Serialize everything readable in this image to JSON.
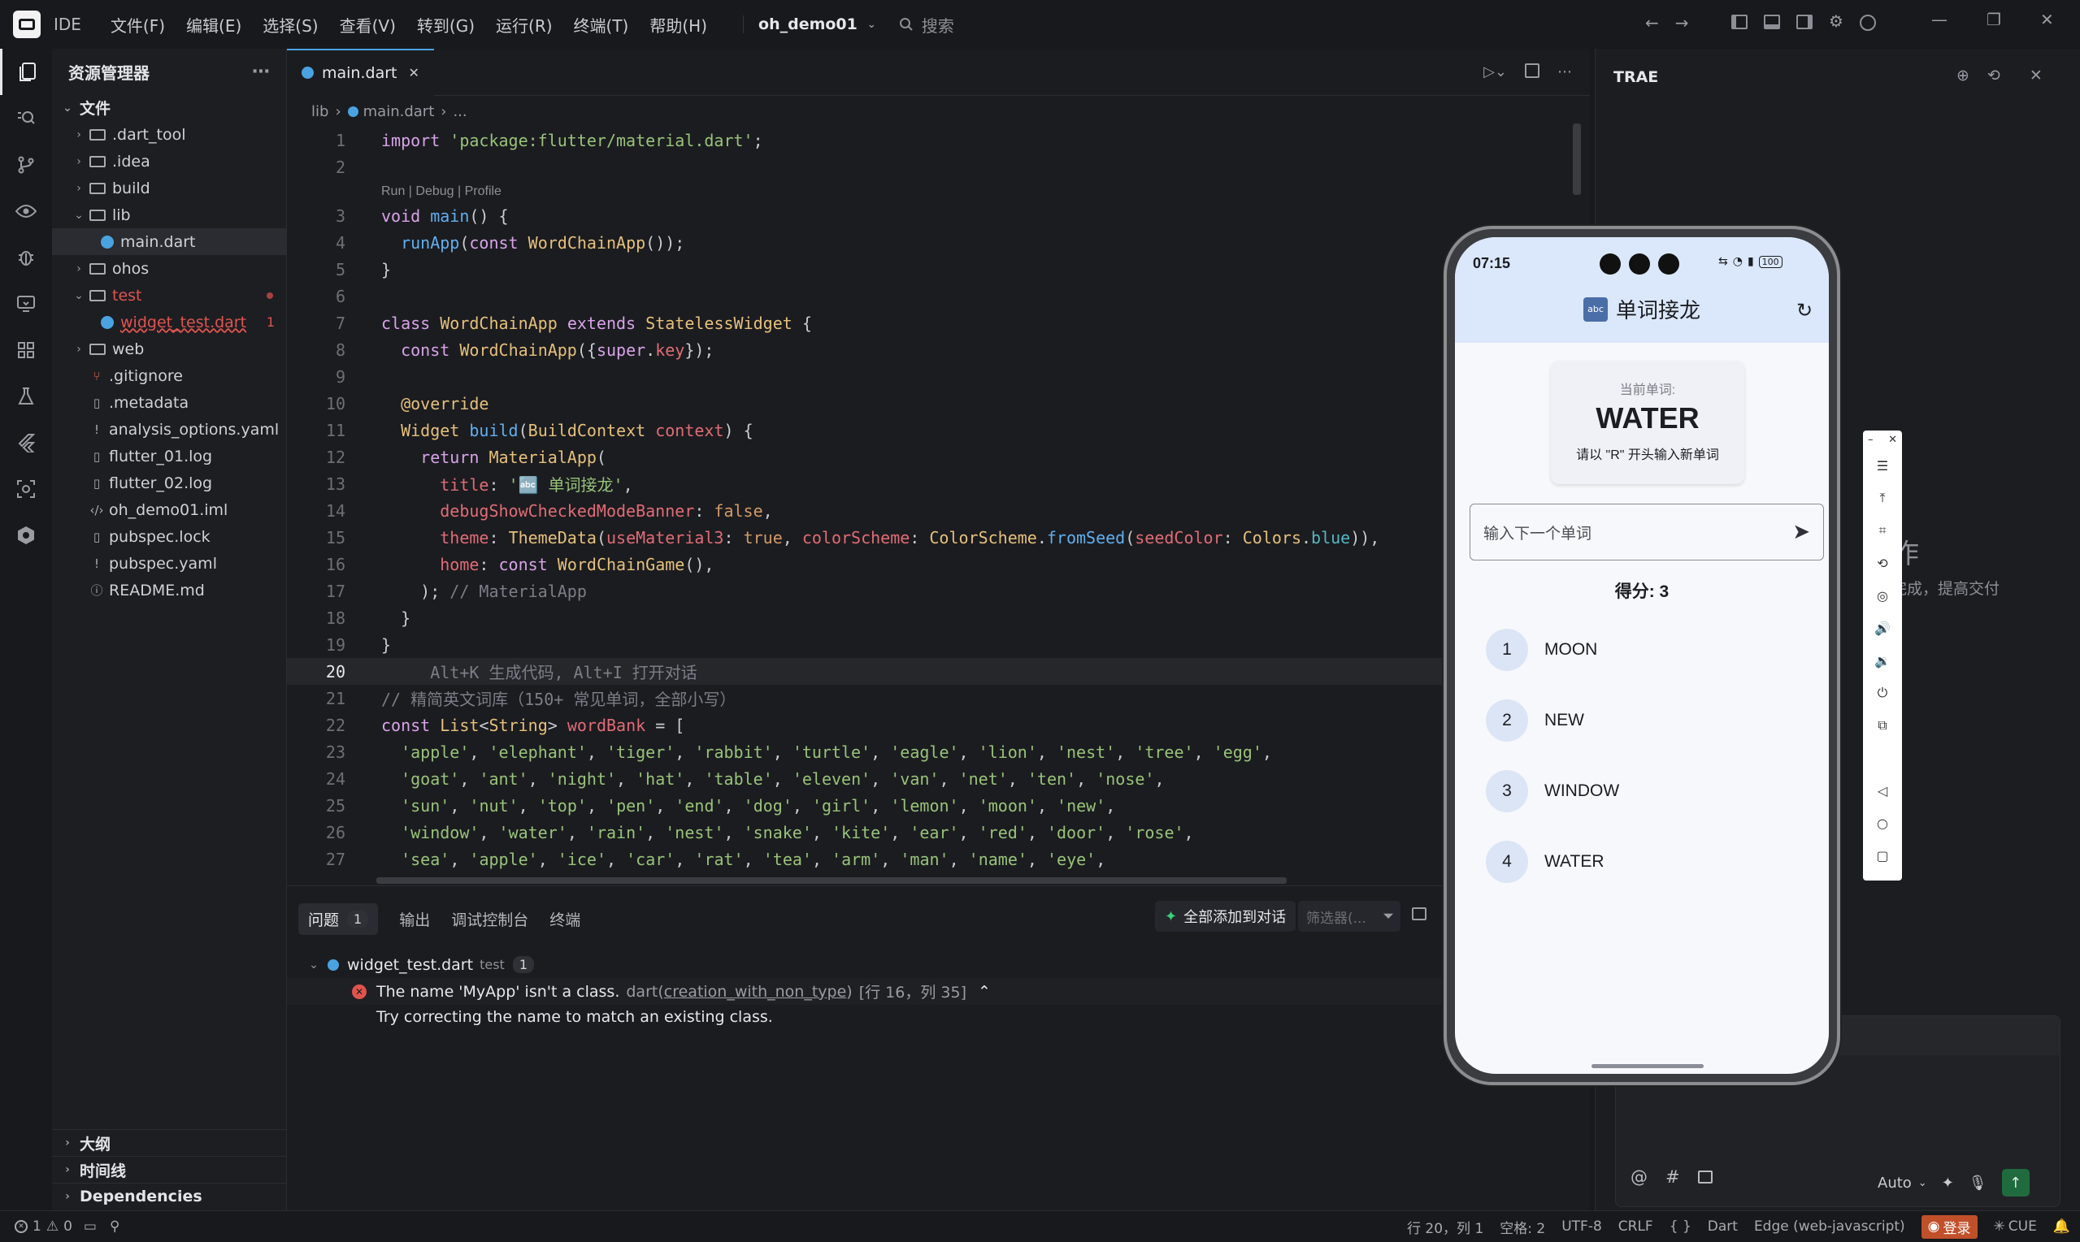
{
  "titlebar": {
    "ide_label": "IDE",
    "menus": [
      "文件(F)",
      "编辑(E)",
      "选择(S)",
      "查看(V)",
      "转到(G)",
      "运行(R)",
      "终端(T)",
      "帮助(H)"
    ],
    "project": "oh_demo01",
    "search_placeholder": "搜索"
  },
  "explorer": {
    "title": "资源管理器",
    "root": "文件",
    "items": [
      {
        "label": ".dart_tool",
        "type": "folder",
        "indent": 1,
        "expanded": false
      },
      {
        "label": ".idea",
        "type": "folder",
        "indent": 1,
        "expanded": false
      },
      {
        "label": "build",
        "type": "folder",
        "indent": 1,
        "expanded": false
      },
      {
        "label": "lib",
        "type": "folder",
        "indent": 1,
        "expanded": true
      },
      {
        "label": "main.dart",
        "type": "dart",
        "indent": 2,
        "selected": true
      },
      {
        "label": "ohos",
        "type": "folder",
        "indent": 1,
        "expanded": false
      },
      {
        "label": "test",
        "type": "folder",
        "indent": 1,
        "expanded": true,
        "error": true
      },
      {
        "label": "widget_test.dart",
        "type": "dart",
        "indent": 2,
        "error": true,
        "error_count": "1"
      },
      {
        "label": "web",
        "type": "folder",
        "indent": 1,
        "expanded": false
      },
      {
        "label": ".gitignore",
        "type": "git",
        "indent": 1
      },
      {
        "label": ".metadata",
        "type": "file",
        "indent": 1
      },
      {
        "label": "analysis_options.yaml",
        "type": "yaml",
        "indent": 1
      },
      {
        "label": "flutter_01.log",
        "type": "file",
        "indent": 1
      },
      {
        "label": "flutter_02.log",
        "type": "file",
        "indent": 1
      },
      {
        "label": "oh_demo01.iml",
        "type": "xml",
        "indent": 1
      },
      {
        "label": "pubspec.lock",
        "type": "file",
        "indent": 1
      },
      {
        "label": "pubspec.yaml",
        "type": "yaml",
        "indent": 1
      },
      {
        "label": "README.md",
        "type": "info",
        "indent": 1
      }
    ],
    "sections": [
      "大纲",
      "时间线",
      "Dependencies"
    ]
  },
  "editor": {
    "tab_label": "main.dart",
    "breadcrumb": [
      "lib",
      "main.dart",
      "..."
    ],
    "codelens": "Run | Debug | Profile",
    "current_line": 20,
    "lines": [
      {
        "n": 1,
        "html": "<span class='k'>import</span> <span class='s'>'package:flutter/material.dart'</span>;"
      },
      {
        "n": 2,
        "html": ""
      },
      {
        "n": 3,
        "html": "<span class='k'>void</span> <span class='f'>main</span>() {",
        "lens": true
      },
      {
        "n": 4,
        "html": "  <span class='f'>runApp</span>(<span class='k'>const</span> <span class='t'>WordChainApp</span>());"
      },
      {
        "n": 5,
        "html": "}"
      },
      {
        "n": 6,
        "html": ""
      },
      {
        "n": 7,
        "html": "<span class='k'>class</span> <span class='t'>WordChainApp</span> <span class='k'>extends</span> <span class='t'>StatelessWidget</span> {"
      },
      {
        "n": 8,
        "html": "  <span class='k'>const</span> <span class='t'>WordChainApp</span>({<span class='k'>super</span>.<span class='r'>key</span>});"
      },
      {
        "n": 9,
        "html": ""
      },
      {
        "n": 10,
        "html": "  <span class='p'>@override</span>"
      },
      {
        "n": 11,
        "html": "  <span class='t'>Widget</span> <span class='f'>build</span>(<span class='t'>BuildContext</span> <span class='r'>context</span>) {"
      },
      {
        "n": 12,
        "html": "    <span class='k'>return</span> <span class='t'>MaterialApp</span>("
      },
      {
        "n": 13,
        "html": "      <span class='r'>title</span>: <span class='s'>'🔤 单词接龙'</span>,"
      },
      {
        "n": 14,
        "html": "      <span class='r'>debugShowCheckedModeBanner</span>: <span class='n'>false</span>,"
      },
      {
        "n": 15,
        "html": "      <span class='r'>theme</span>: <span class='t'>ThemeData</span>(<span class='r'>useMaterial3</span>: <span class='n'>true</span>, <span class='r'>colorScheme</span>: <span class='t'>ColorScheme</span>.<span class='f'>fromSeed</span>(<span class='r'>seedColor</span>: <span class='t'>Colors</span>.<span class='b'>blue</span>)),"
      },
      {
        "n": 16,
        "html": "      <span class='r'>home</span>: <span class='k'>const</span> <span class='t'>WordChainGame</span>(),"
      },
      {
        "n": 17,
        "html": "    ); <span class='c'>// MaterialApp</span>"
      },
      {
        "n": 18,
        "html": "  }"
      },
      {
        "n": 19,
        "html": "}"
      },
      {
        "n": 20,
        "html": "     <span class='c'>Alt+K 生成代码, Alt+I 打开对话</span>"
      },
      {
        "n": 21,
        "html": "<span class='c'>// 精简英文词库（150+ 常见单词，全部小写）</span>"
      },
      {
        "n": 22,
        "html": "<span class='k'>const</span> <span class='t'>List</span>&lt;<span class='t'>String</span>&gt; <span class='r'>wordBank</span> = ["
      },
      {
        "n": 23,
        "html": "  <span class='s'>'apple'</span>, <span class='s'>'elephant'</span>, <span class='s'>'tiger'</span>, <span class='s'>'rabbit'</span>, <span class='s'>'turtle'</span>, <span class='s'>'eagle'</span>, <span class='s'>'lion'</span>, <span class='s'>'nest'</span>, <span class='s'>'tree'</span>, <span class='s'>'egg'</span>,"
      },
      {
        "n": 24,
        "html": "  <span class='s'>'goat'</span>, <span class='s'>'ant'</span>, <span class='s'>'night'</span>, <span class='s'>'hat'</span>, <span class='s'>'table'</span>, <span class='s'>'eleven'</span>, <span class='s'>'van'</span>, <span class='s'>'net'</span>, <span class='s'>'ten'</span>, <span class='s'>'nose'</span>,"
      },
      {
        "n": 25,
        "html": "  <span class='s'>'sun'</span>, <span class='s'>'nut'</span>, <span class='s'>'top'</span>, <span class='s'>'pen'</span>, <span class='s'>'end'</span>, <span class='s'>'dog'</span>, <span class='s'>'girl'</span>, <span class='s'>'lemon'</span>, <span class='s'>'moon'</span>, <span class='s'>'new'</span>,"
      },
      {
        "n": 26,
        "html": "  <span class='s'>'window'</span>, <span class='s'>'water'</span>, <span class='s'>'rain'</span>, <span class='s'>'nest'</span>, <span class='s'>'snake'</span>, <span class='s'>'kite'</span>, <span class='s'>'ear'</span>, <span class='s'>'red'</span>, <span class='s'>'door'</span>, <span class='s'>'rose'</span>,"
      },
      {
        "n": 27,
        "html": "  <span class='s'>'sea'</span>, <span class='s'>'apple'</span>, <span class='s'>'ice'</span>, <span class='s'>'car'</span>, <span class='s'>'rat'</span>, <span class='s'>'tea'</span>, <span class='s'>'arm'</span>, <span class='s'>'man'</span>, <span class='s'>'name'</span>, <span class='s'>'eye'</span>,"
      }
    ]
  },
  "panel": {
    "tabs": [
      "问题",
      "输出",
      "调试控制台",
      "终端"
    ],
    "problems_count": "1",
    "add_all_label": "全部添加到对话",
    "filter_placeholder": "筛选器(...",
    "file": "widget_test.dart",
    "file_dir": "test",
    "file_count": "1",
    "error_msg": "The name 'MyApp' isn't a class.",
    "error_source": "dart",
    "error_code": "creation_with_non_type",
    "error_pos": "[行 16，列 35]",
    "error_hint": "Try correcting the name to match an existing class."
  },
  "trae": {
    "title": "TRAE",
    "bg_heading": "作",
    "bg_text": "完成，提高交付",
    "input_auto": "Auto"
  },
  "phone": {
    "time": "07:15",
    "battery": "100",
    "app_title": "单词接龙",
    "app_icon_text": "abc",
    "current_label": "当前单词:",
    "current_word": "WATER",
    "hint": "请以 \"R\" 开头输入新单词",
    "input_placeholder": "输入下一个单词",
    "score": "得分: 3",
    "words": [
      {
        "n": "1",
        "w": "MOON"
      },
      {
        "n": "2",
        "w": "NEW"
      },
      {
        "n": "3",
        "w": "WINDOW"
      },
      {
        "n": "4",
        "w": "WATER"
      }
    ]
  },
  "statusbar": {
    "errors": "1",
    "warnings": "0",
    "position": "行 20，列 1",
    "spaces": "空格: 2",
    "encoding": "UTF-8",
    "eol": "CRLF",
    "braces": "{ }",
    "language": "Dart",
    "browser": "Edge (web-javascript)",
    "login": "登录",
    "cue": "CUE"
  }
}
